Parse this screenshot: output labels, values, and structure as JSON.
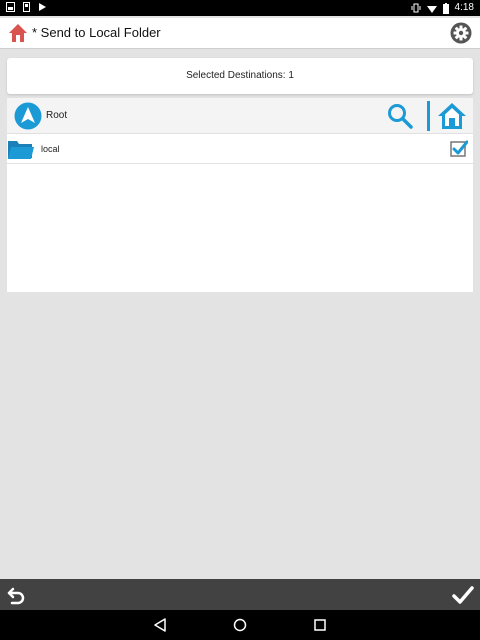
{
  "status_bar": {
    "time": "4:18",
    "left_icons": [
      "gallery-icon",
      "sim-icon",
      "play-store-icon"
    ],
    "right_icons": [
      "vibrate-icon",
      "wifi-icon",
      "battery-icon"
    ]
  },
  "header": {
    "title": "* Send to Local Folder",
    "home_icon": "home-icon",
    "settings_icon": "gear-icon"
  },
  "destinations": {
    "text": "Selected Destinations: 1"
  },
  "browser": {
    "path_label": "Root",
    "items": [
      {
        "label": "local",
        "checked": true
      }
    ]
  },
  "colors": {
    "accent": "#1b9ad6",
    "home_red": "#d9534f",
    "bottom_bar": "#424242",
    "background": "#e3e3e3"
  }
}
